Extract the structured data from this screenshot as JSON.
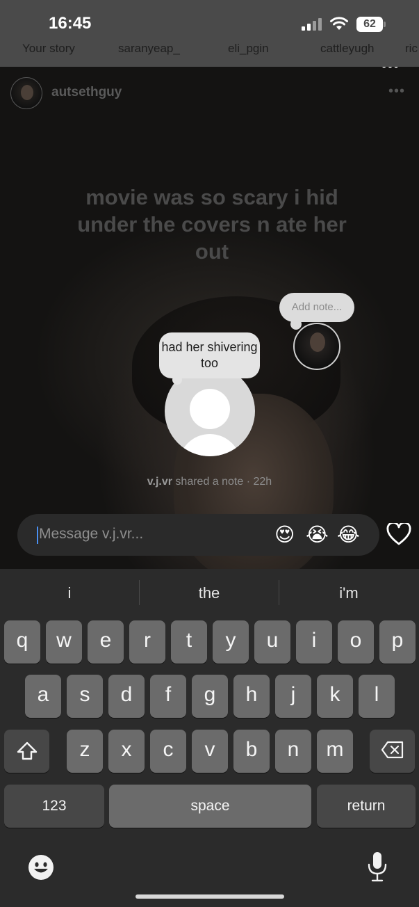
{
  "status": {
    "time": "16:45",
    "battery": "62"
  },
  "stories_strip": [
    "Your story",
    "saranyeap_",
    "eli_pgin",
    "cattleyugh",
    "ric"
  ],
  "story": {
    "username": "autsethguy",
    "caption": "movie was so scary i hid under the covers n ate her out"
  },
  "notes": {
    "own_placeholder": "Add note...",
    "friend_text": "had her shivering too",
    "shared_user": "v.j.vr",
    "shared_suffix": "shared a note · 22h"
  },
  "message": {
    "placeholder": "Message v.j.vr...",
    "quick_reactions": [
      "😍",
      "😭",
      "😂"
    ]
  },
  "keyboard": {
    "suggestions": [
      "i",
      "the",
      "i'm"
    ],
    "row1": [
      "q",
      "w",
      "e",
      "r",
      "t",
      "y",
      "u",
      "i",
      "o",
      "p"
    ],
    "row2": [
      "a",
      "s",
      "d",
      "f",
      "g",
      "h",
      "j",
      "k",
      "l"
    ],
    "row3": [
      "z",
      "x",
      "c",
      "v",
      "b",
      "n",
      "m"
    ],
    "numbers_label": "123",
    "space_label": "space",
    "return_label": "return"
  }
}
